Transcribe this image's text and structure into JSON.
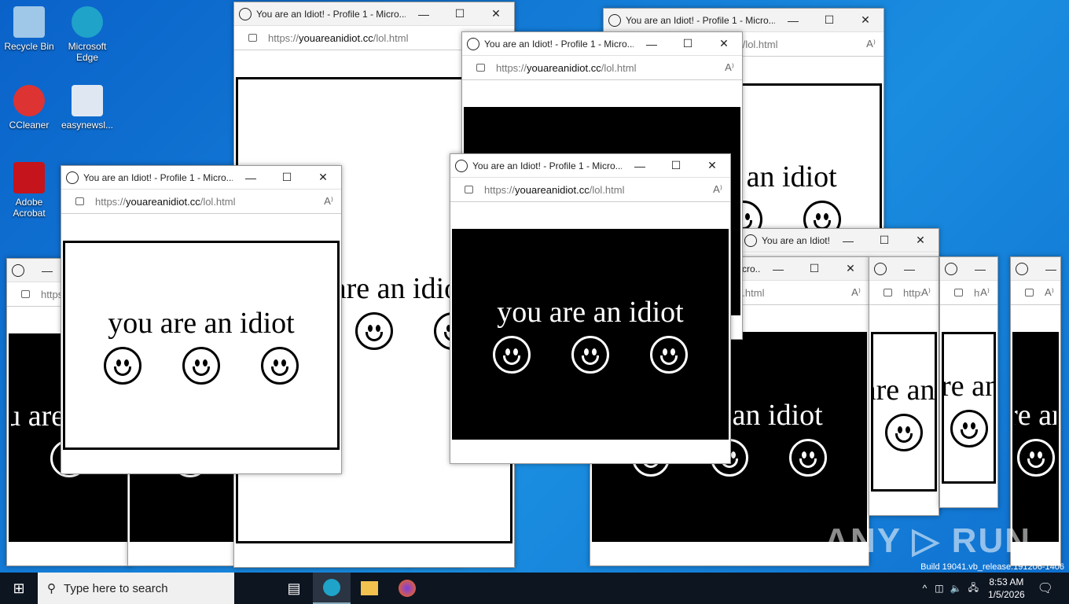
{
  "desktop": {
    "icons": [
      {
        "label": "Recycle Bin",
        "color": "#9fc7e8"
      },
      {
        "label": "Microsoft Edge",
        "color": "#1fa3c9"
      },
      {
        "label": "CCleaner",
        "color": "#d33"
      },
      {
        "label": "easynewsl...",
        "color": "#dfe8f2"
      },
      {
        "label": "Adobe Acrobat",
        "color": "#c5141b"
      }
    ]
  },
  "windows": [
    {
      "title": "You are an Idiot! - Profile 1 - Microsoft Edge",
      "url_prefix": "https://",
      "url_host": "youareanidiot.cc",
      "url_path": "/lol.html",
      "phrase": "you are an idiot",
      "theme": "dark"
    },
    {
      "title": "You are an Idiot! - Profile 1 - Microsoft Edge",
      "url_prefix": "https://",
      "url_host": "youareanidiot.cc",
      "url_path": "/lol.html",
      "phrase": "you are an idiot",
      "theme": "dark"
    },
    {
      "title": "You are an Idiot! - Profile 1 - Micro...",
      "url_prefix": "https://",
      "url_host": "youareanidiot.cc",
      "url_path": "/lol.html",
      "phrase": "you are an idiot",
      "theme": "light"
    },
    {
      "title": "You are an Idiot! - Profile 1 - Micro...",
      "url_prefix": "https://",
      "url_host": "youareanidiot.cc",
      "url_path": "/lol.html",
      "phrase": "you are an idiot",
      "theme": "light"
    },
    {
      "title": "You are an Idiot! - Profile 1 - Micro...",
      "url_prefix": "https://",
      "url_host": "youareanidiot.cc",
      "url_path": "/lol.html",
      "phrase": "you are an idiot",
      "theme": "light"
    },
    {
      "title": "You are an Idiot! - Profile 1 - Micro...",
      "url_prefix": "https://",
      "url_host": "youareanidiot.cc",
      "url_path": "/lol.html",
      "phrase": "you are an idiot",
      "theme": "light"
    },
    {
      "title": "You are an Idiot! - Profile 1 - Micro...",
      "url_prefix": "https://",
      "url_host": "youareanidiot.cc",
      "url_path": "/lol.html",
      "phrase": "you are an idiot",
      "theme": "dark"
    },
    {
      "title": "You are an Idiot! - Profile 1 - Micro...",
      "url_prefix": "https://",
      "url_host": "youareanidiot.cc",
      "url_path": "/lol.html",
      "phrase": "you are an idiot",
      "theme": "light"
    },
    {
      "title": "You are an Idiot! - Profile 1 - Micro...",
      "url_prefix": "https://",
      "url_host": "youareanidiot.cc",
      "url_path": "/lol.html",
      "phrase": "you are an idiot",
      "theme": "light"
    },
    {
      "title": "You are an Idiot! - Profile 1 - Micro...",
      "url_prefix": "https://",
      "url_host": "youareanidiot.cc",
      "url_path": "/lol.html",
      "phrase": "you are an idiot",
      "theme": "dark"
    },
    {
      "title": "You are an Idiot! - Profile 1 - Micro...",
      "url_prefix": "https://",
      "url_host": "youareanidiot.cc",
      "url_path": "/lol.html",
      "phrase": "you are an idiot",
      "theme": "dark"
    },
    {
      "title": "You are an Idiot! - Profile 1 - Micro...",
      "url_prefix": "https://",
      "url_host": "youareanidiot.cc",
      "url_path": "/lol.html",
      "phrase": "you are an idiot",
      "theme": "light"
    }
  ],
  "window_controls": {
    "minimize": "—",
    "maximize": "☐",
    "close": "✕",
    "read_aloud": "A⁾"
  },
  "taskbar": {
    "search_placeholder": "Type here to search",
    "time": "8:53 AM",
    "date": "1/5/2026",
    "tray_chevron": "^"
  },
  "watermark": "ANY ▷ RUN",
  "build_text": "Build 19041.vb_release.191206-1406"
}
